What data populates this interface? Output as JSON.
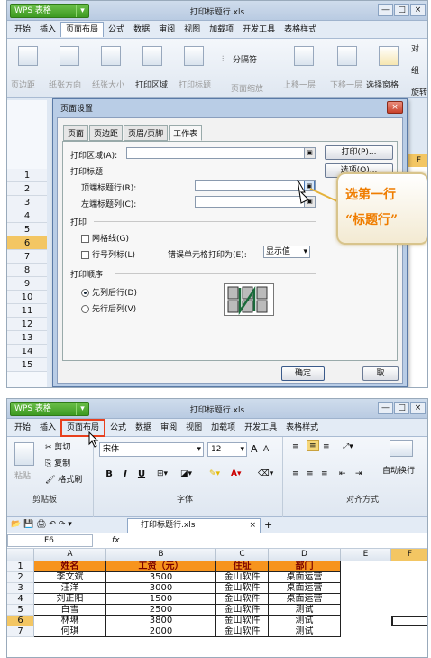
{
  "top": {
    "logo": "WPS 表格",
    "window_title": "打印标题行.xls",
    "window_btns": [
      "—",
      "□",
      "×"
    ],
    "menu": [
      "开始",
      "插入",
      "页面布局",
      "公式",
      "数据",
      "审阅",
      "视图",
      "加载项",
      "开发工具",
      "表格样式"
    ],
    "ribbon": [
      "页边距",
      "纸张方向",
      "纸张大小",
      "打印区域",
      "打印标题",
      "页面缩放",
      "分隔符",
      "上移一层",
      "下移一层",
      "选择窗格",
      "旋转"
    ],
    "ribbon_right": [
      "对",
      "组"
    ],
    "rows": [
      "1",
      "2",
      "3",
      "4",
      "5",
      "6",
      "7",
      "8",
      "9",
      "10",
      "11",
      "12",
      "13",
      "14",
      "15"
    ],
    "col_f": "F",
    "dialog": {
      "title": "页面设置",
      "close": "×",
      "tabs": [
        "页面",
        "页边距",
        "页眉/页脚",
        "工作表"
      ],
      "print_area_label": "打印区域(A):",
      "print_btn": "打印(P)...",
      "options_btn": "选项(O)...",
      "print_titles_label": "打印标题",
      "top_rows_label": "顶端标题行(R):",
      "left_cols_label": "左端标题列(C):",
      "print_label": "打印",
      "gridlines": "网格线(G)",
      "rowcol_headers": "行号列标(L)",
      "errors_label": "错误单元格打印为(E):",
      "errors_value": "显示值",
      "order_label": "打印顺序",
      "down_then_over": "先列后行(D)",
      "over_then_down": "先行后列(V)",
      "ok": "确定",
      "cancel": "取"
    },
    "callout_line1": "选第一行",
    "callout_line2": "“标题行”"
  },
  "bottom": {
    "logo": "WPS 表格",
    "window_title": "打印标题行.xls",
    "window_btns": [
      "—",
      "□",
      "×"
    ],
    "menu": [
      "开始",
      "插入",
      "页面布局",
      "公式",
      "数据",
      "审阅",
      "视图",
      "加载项",
      "开发工具",
      "表格样式"
    ],
    "clipboard": {
      "paste": "粘贴",
      "cut": "剪切",
      "copy": "复制",
      "format_painter": "格式刷",
      "group": "剪贴板"
    },
    "font": {
      "name": "宋体",
      "size": "12",
      "group": "字体",
      "bold": "B",
      "italic": "I",
      "underline": "U"
    },
    "align": {
      "wrap": "自动换行",
      "group": "对齐方式"
    },
    "doc_tab": "打印标题行.xls",
    "doc_tab_close": "×",
    "new_tab": "+",
    "cell_ref": "F6",
    "fx": "fx",
    "columns": [
      "A",
      "B",
      "C",
      "D",
      "E",
      "F"
    ],
    "rows": [
      "1",
      "2",
      "3",
      "4",
      "5",
      "6",
      "7"
    ],
    "table": [
      [
        "姓名",
        "工资（元）",
        "住址",
        "部门"
      ],
      [
        "李文斌",
        "3500",
        "金山软件",
        "桌面运营"
      ],
      [
        "汪洋",
        "3000",
        "金山软件",
        "桌面运营"
      ],
      [
        "刘正阳",
        "1500",
        "金山软件",
        "桌面运营"
      ],
      [
        "白雪",
        "2500",
        "金山软件",
        "测试"
      ],
      [
        "林琳",
        "3800",
        "金山软件",
        "测试"
      ],
      [
        "何琪",
        "2000",
        "金山软件",
        "测试"
      ]
    ]
  }
}
